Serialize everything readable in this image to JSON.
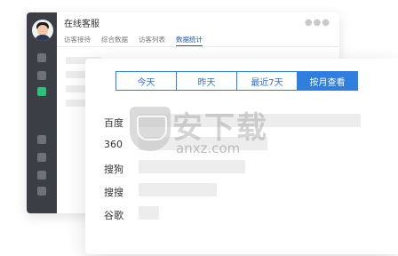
{
  "back": {
    "title": "在线客服",
    "dots": "●●●",
    "tabs": [
      "访客接待",
      "综合数据",
      "访客列表",
      "数据统计"
    ],
    "active_tab": "数据统计"
  },
  "front": {
    "segments": [
      "今天",
      "昨天",
      "最近7天",
      "按月查看"
    ],
    "active_segment": "按月查看",
    "stats": [
      {
        "label": "百度",
        "value": 1.0
      },
      {
        "label": "360",
        "value": 0.58
      },
      {
        "label": "搜狗",
        "value": 0.48
      },
      {
        "label": "搜搜",
        "value": 0.35
      },
      {
        "label": "谷歌",
        "value": 0.09
      }
    ]
  },
  "watermark": {
    "text": "安下载",
    "domain": "anxz.com",
    "shield_char": "安"
  },
  "colors": {
    "accent": "#2f7fe0",
    "sidebar": "#3b3e44",
    "active_icon": "#2bc17b"
  }
}
